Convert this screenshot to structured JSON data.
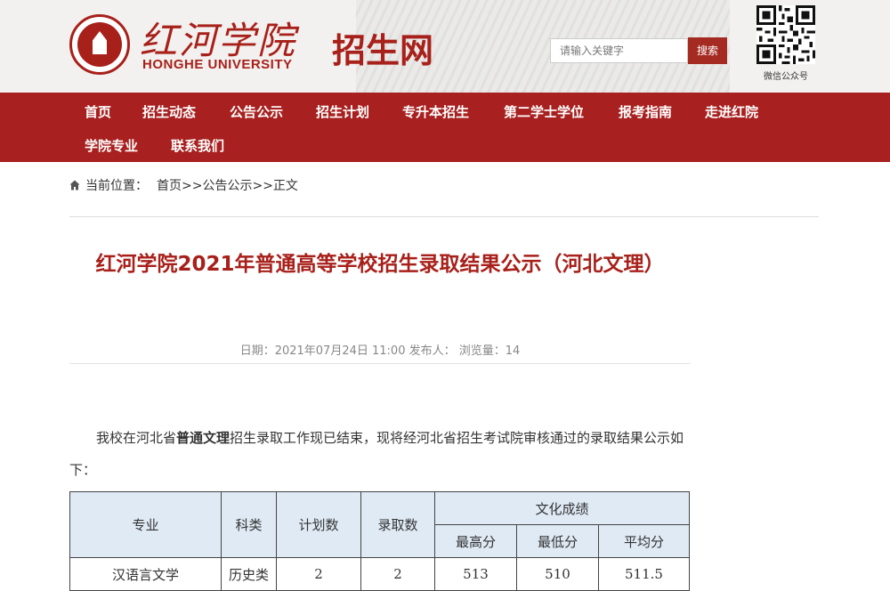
{
  "header": {
    "logo_cn": "红河学院",
    "logo_en": "HONGHE UNIVERSITY",
    "site_name": "招生网",
    "search_placeholder": "请输入关键字",
    "search_button": "搜索",
    "qr_label": "微信公众号"
  },
  "nav": {
    "items": [
      "首页",
      "招生动态",
      "公告公示",
      "招生计划",
      "专升本招生",
      "第二学士学位",
      "报考指南",
      "走进红院",
      "学院专业",
      "联系我们"
    ]
  },
  "breadcrumb": {
    "label": "当前位置：",
    "path": "首页>>公告公示>>正文"
  },
  "article": {
    "title": "红河学院2021年普通高等学校招生录取结果公示（河北文理）",
    "meta": "日期：2021年07月24日 11:00  发布人：  浏览量：14",
    "para_a": "我校在河北省",
    "para_bold": "普通文理",
    "para_b": "招生录取工作现已结束，现将经河北省招生考试院审核通过的录取结果公示如下："
  },
  "table": {
    "headers": {
      "major": "专业",
      "category": "科类",
      "plan": "计划数",
      "admitted": "录取数",
      "scores": "文化成绩",
      "max": "最高分",
      "min": "最低分",
      "avg": "平均分"
    },
    "rows": [
      {
        "major": "汉语言文学",
        "category": "历史类",
        "plan": "2",
        "admitted": "2",
        "max": "513",
        "min": "510",
        "avg": "511.5"
      }
    ]
  },
  "colors": {
    "brand": "#a8201f",
    "table_header": "#dfeaf5"
  }
}
